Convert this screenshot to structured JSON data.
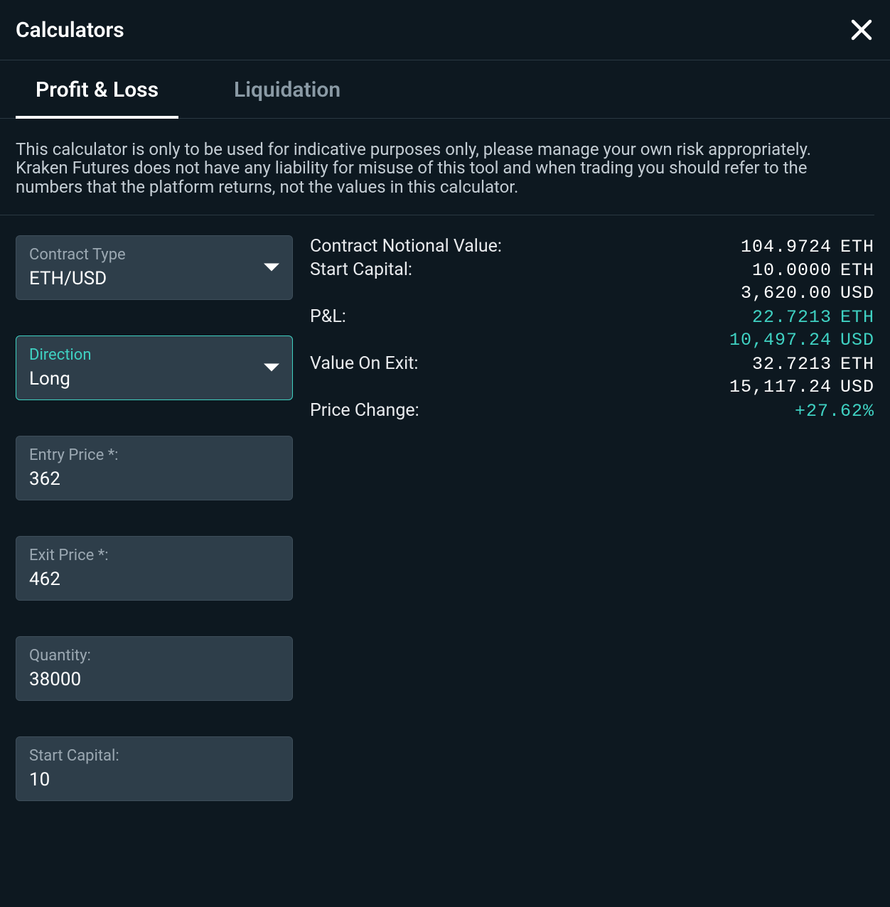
{
  "header": {
    "title": "Calculators"
  },
  "tabs": {
    "profit_loss": "Profit & Loss",
    "liquidation": "Liquidation"
  },
  "disclaimer": "This calculator is only to be used for indicative purposes only, please manage your own risk appropriately. Kraken Futures does not have any liability for misuse of this tool and when trading you should refer to the numbers that the platform returns, not the values in this calculator.",
  "form": {
    "contract_type": {
      "label": "Contract Type",
      "value": "ETH/USD"
    },
    "direction": {
      "label": "Direction",
      "value": "Long"
    },
    "entry_price": {
      "label": "Entry Price *:",
      "value": "362"
    },
    "exit_price": {
      "label": "Exit Price *:",
      "value": "462"
    },
    "quantity": {
      "label": "Quantity:",
      "value": "38000"
    },
    "start_capital": {
      "label": "Start Capital:",
      "value": "10"
    }
  },
  "results": {
    "contract_notional": {
      "label": "Contract Notional Value:",
      "value": "104.9724",
      "unit": "ETH"
    },
    "start_capital_eth": {
      "label": "Start Capital:",
      "value": "10.0000",
      "unit": "ETH"
    },
    "start_capital_usd": {
      "value": "3,620.00",
      "unit": "USD"
    },
    "pnl_eth": {
      "label": "P&L:",
      "value": "22.7213",
      "unit": "ETH"
    },
    "pnl_usd": {
      "value": "10,497.24",
      "unit": "USD"
    },
    "value_on_exit_eth": {
      "label": "Value On Exit:",
      "value": "32.7213",
      "unit": "ETH"
    },
    "value_on_exit_usd": {
      "value": "15,117.24",
      "unit": "USD"
    },
    "price_change": {
      "label": "Price Change:",
      "value": "+27.62%"
    }
  }
}
